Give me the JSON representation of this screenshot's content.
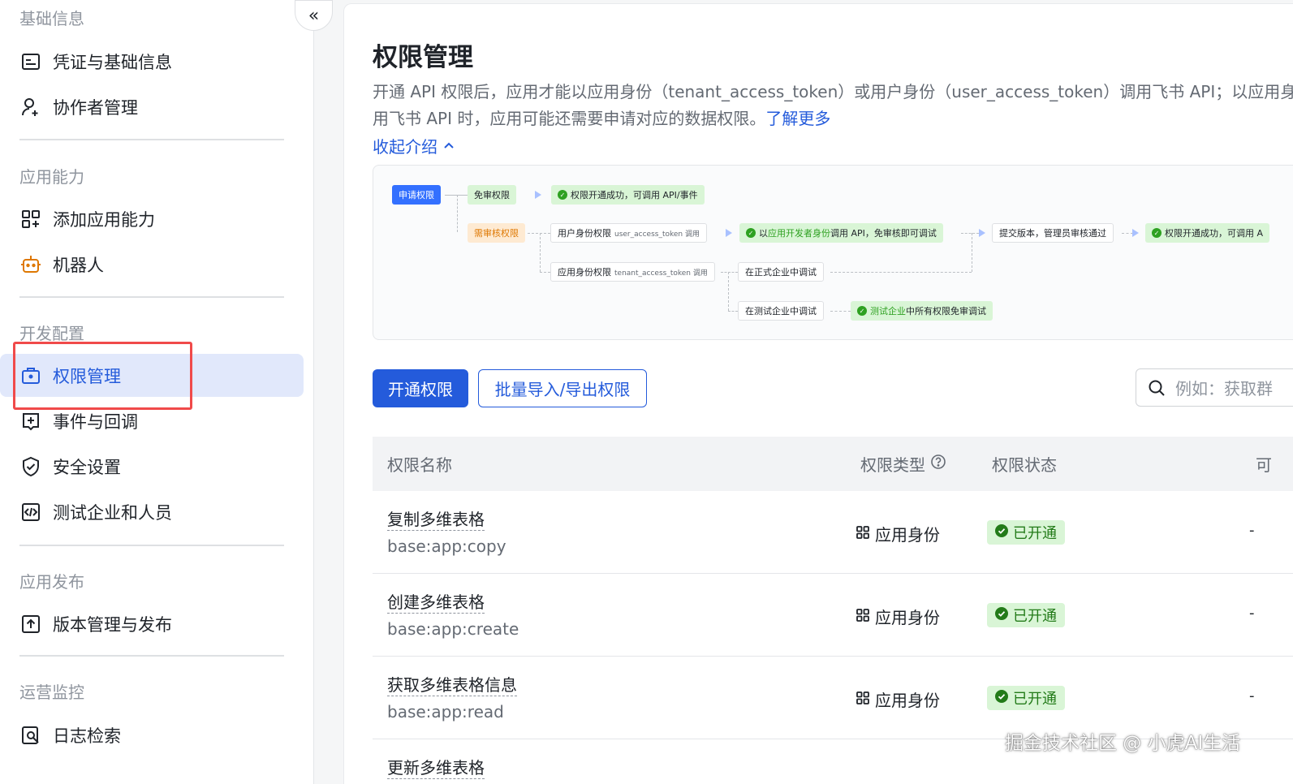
{
  "sidebar": {
    "sections": [
      {
        "title": "基础信息",
        "items": [
          {
            "label": "凭证与基础信息",
            "icon": "id-card-icon"
          },
          {
            "label": "协作者管理",
            "icon": "user-add-icon"
          }
        ]
      },
      {
        "title": "应用能力",
        "items": [
          {
            "label": "添加应用能力",
            "icon": "grid-add-icon"
          },
          {
            "label": "机器人",
            "icon": "robot-icon"
          }
        ]
      },
      {
        "title": "开发配置",
        "items": [
          {
            "label": "权限管理",
            "icon": "briefcase-lock-icon",
            "active": true
          },
          {
            "label": "事件与回调",
            "icon": "event-add-icon"
          },
          {
            "label": "安全设置",
            "icon": "shield-check-icon"
          },
          {
            "label": "测试企业和人员",
            "icon": "code-window-icon"
          }
        ]
      },
      {
        "title": "应用发布",
        "items": [
          {
            "label": "版本管理与发布",
            "icon": "upload-box-icon"
          }
        ]
      },
      {
        "title": "运营监控",
        "items": [
          {
            "label": "日志检索",
            "icon": "log-search-icon"
          }
        ]
      }
    ],
    "collapse_glyph": "«"
  },
  "main": {
    "title": "权限管理",
    "description_line1": "开通 API 权限后，应用才能以应用身份（tenant_access_token）或用户身份（user_access_token）调用飞书 API；以应用身",
    "description_line2": "用飞书 API 时，应用可能还需要申请对应的数据权限。",
    "learn_more": "了解更多",
    "collapse_intro": "收起介绍",
    "flow": {
      "apply": "申请权限",
      "free": "免审权限",
      "success1": "权限开通成功，可调用 API/事件",
      "review": "需审核权限",
      "user_perm": "用户身份权限",
      "user_perm_sub": "user_access_token 调用",
      "dev_call_pre": "以",
      "dev_call_green": "应用开发者身份",
      "dev_call_post": "调用 API，免审核即可调试",
      "submit": "提交版本，管理员审核通过",
      "success2": "权限开通成功，可调用 A",
      "app_perm": "应用身份权限",
      "app_perm_sub": "tenant_access_token 调用",
      "formal": "在正式企业中调试",
      "test": "在测试企业中调试",
      "test_free_green": "测试企业",
      "test_free_post": "中所有权限免审调试"
    },
    "buttons": {
      "enable": "开通权限",
      "batch": "批量导入/导出权限"
    },
    "search": {
      "placeholder": "例如：获取群"
    },
    "table": {
      "headers": {
        "name": "权限名称",
        "type": "权限类型",
        "status": "权限状态",
        "extra": "可"
      },
      "rows": [
        {
          "name": "复制多维表格",
          "code": "base:app:copy",
          "type": "应用身份",
          "status": "已开通",
          "extra": "-"
        },
        {
          "name": "创建多维表格",
          "code": "base:app:create",
          "type": "应用身份",
          "status": "已开通",
          "extra": "-"
        },
        {
          "name": "获取多维表格信息",
          "code": "base:app:read",
          "type": "应用身份",
          "status": "已开通",
          "extra": "-"
        },
        {
          "name": "更新多维表格",
          "code": "",
          "type": "",
          "status": "",
          "extra": ""
        }
      ]
    }
  },
  "watermark": "掘金技术社区 @ 小虎AI生活",
  "colors": {
    "accent": "#245bdb",
    "active_bg": "#e1e8fb",
    "success_bg": "#d9f5d6",
    "success": "#2ea121",
    "highlight": "#f04a4a"
  }
}
